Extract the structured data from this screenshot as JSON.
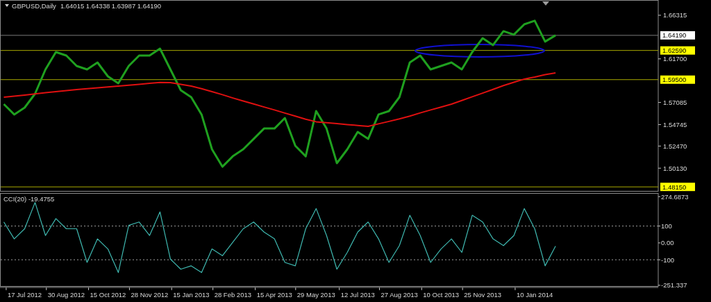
{
  "price_chart": {
    "ohlc": "1.64015 1.64338 1.63987 1.64190",
    "chart_data": {
      "type": "line",
      "title": "GBPUSD,Daily",
      "series": [
        {
          "color": "#1fa01f",
          "values": [
            1.5691,
            1.5581,
            1.5654,
            1.5801,
            1.6058,
            1.6242,
            1.6205,
            1.6095,
            1.6058,
            1.6132,
            1.5985,
            1.5911,
            1.6095,
            1.6205,
            1.6205,
            1.6279,
            1.6058,
            1.5838,
            1.5764,
            1.5581,
            1.5213,
            1.5029,
            1.5139,
            1.5213,
            1.5323,
            1.5433,
            1.5433,
            1.5544,
            1.525,
            1.5139,
            1.5617,
            1.5433,
            1.5066,
            1.5213,
            1.5397,
            1.5323,
            1.5581,
            1.5617,
            1.5764,
            1.6132,
            1.6205,
            1.6058,
            1.6095,
            1.6132,
            1.6058,
            1.6242,
            1.6389,
            1.6316,
            1.6463,
            1.6426,
            1.6536,
            1.6573,
            1.6353,
            1.6419
          ]
        },
        {
          "color": "#e01010",
          "values": [
            1.5764,
            1.5776,
            1.5787,
            1.5799,
            1.5811,
            1.5823,
            1.5835,
            1.5845,
            1.5854,
            1.5863,
            1.5872,
            1.5882,
            1.5891,
            1.59,
            1.5911,
            1.592,
            1.5919,
            1.5901,
            1.5882,
            1.5855,
            1.5823,
            1.5791,
            1.5756,
            1.5724,
            1.5692,
            1.5661,
            1.5629,
            1.5596,
            1.5564,
            1.5531,
            1.5504,
            1.5494,
            1.5484,
            1.5475,
            1.5465,
            1.5456,
            1.5482,
            1.5508,
            1.5534,
            1.5564,
            1.5598,
            1.5629,
            1.566,
            1.5691,
            1.573,
            1.5769,
            1.5808,
            1.5847,
            1.5888,
            1.5922,
            1.5956,
            1.5978,
            1.6003,
            1.6022
          ]
        }
      ],
      "ylim": [
        1.4765,
        1.6793
      ],
      "yticks": [
        {
          "value": 1.66315,
          "label": "1.66315"
        },
        {
          "value": 1.617,
          "label": "1.61700"
        },
        {
          "value": 1.57085,
          "label": "1.57085"
        },
        {
          "value": 1.54745,
          "label": "1.54745"
        },
        {
          "value": 1.5247,
          "label": "1.52470"
        },
        {
          "value": 1.5013,
          "label": "1.50130"
        }
      ],
      "ref_lines": [
        {
          "axis": "y",
          "value": 1.6419,
          "label": "1.64190",
          "color": "#7a7a7a"
        },
        {
          "axis": "y",
          "value": 1.6259,
          "label": "1.62590",
          "color": "#a8a800"
        },
        {
          "axis": "y",
          "value": 1.595,
          "label": "1.59500",
          "color": "#a8a800"
        },
        {
          "axis": "y",
          "value": 1.4815,
          "label": "1.48150",
          "color": "#a8a800"
        }
      ]
    },
    "marking": {
      "color": "#1010d0"
    }
  },
  "cci_indicator": {
    "chart_data": {
      "type": "line",
      "title": "CCI(20) -19.4755",
      "categories": [
        null,
        null,
        "17 Jul 2012",
        null,
        null,
        null,
        "30 Aug 2012",
        null,
        null,
        null,
        "15 Oct 2012",
        null,
        null,
        null,
        "28 Nov 2012",
        null,
        null,
        null,
        "15 Jan 2013",
        null,
        null,
        null,
        "28 Feb 2013",
        null,
        null,
        null,
        "15 Apr 2013",
        null,
        null,
        null,
        "29 May 2013",
        null,
        null,
        null,
        "12 Jul 2013",
        null,
        null,
        null,
        "27 Aug 2013",
        null,
        null,
        null,
        "10 Oct 2013",
        null,
        null,
        null,
        "25 Nov 2013",
        null,
        null,
        null,
        null,
        "10 Jan 2014",
        null,
        null
      ],
      "series": [
        {
          "color": "#3fb8b0",
          "values": [
            124,
            24,
            84,
            240,
            44,
            144,
            84,
            84,
            -116,
            24,
            -36,
            -176,
            104,
            124,
            44,
            184,
            -96,
            -156,
            -136,
            -176,
            -36,
            -76,
            4,
            84,
            124,
            64,
            24,
            -116,
            -136,
            84,
            204,
            44,
            -156,
            -56,
            64,
            124,
            24,
            -116,
            -16,
            164,
            44,
            -116,
            -36,
            24,
            -56,
            164,
            124,
            24,
            -16,
            44,
            204,
            84,
            -136,
            -19
          ]
        }
      ],
      "ylim": [
        -260,
        292
      ],
      "yticks": [
        {
          "value": 274.6873,
          "label": "274.6873"
        },
        {
          "value": 100,
          "label": "100"
        },
        {
          "value": 0,
          "label": "0.00"
        },
        {
          "value": -100,
          "label": "-100"
        },
        {
          "value": -251.337,
          "label": "-251.337"
        }
      ],
      "ref_lines": [
        {
          "axis": "y",
          "value": 100,
          "color": "#a0a0a0"
        },
        {
          "axis": "y",
          "value": -100,
          "color": "#a0a0a0"
        }
      ]
    }
  }
}
